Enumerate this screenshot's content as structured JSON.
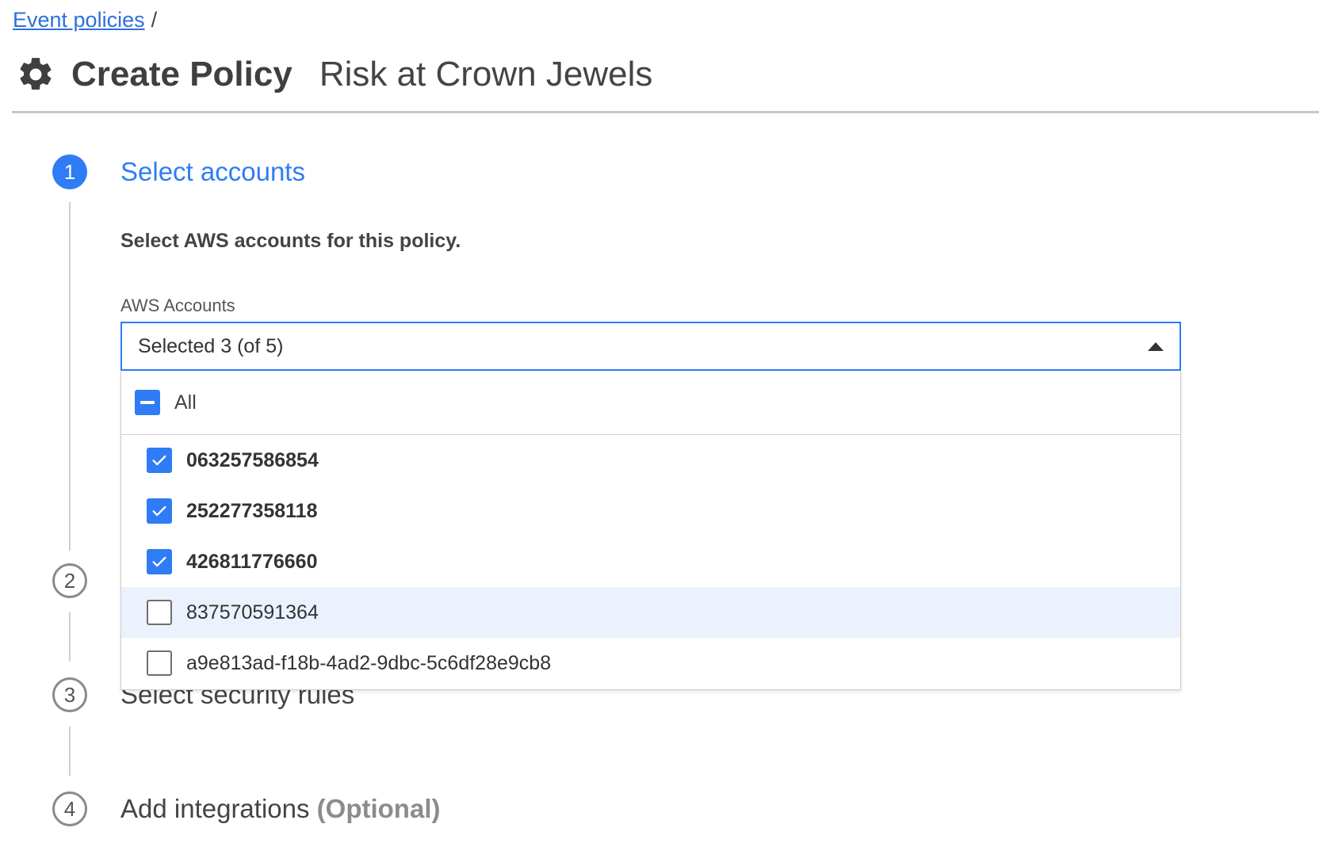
{
  "breadcrumb": {
    "link": "Event policies",
    "separator": "/"
  },
  "header": {
    "icon": "gear-icon",
    "title": "Create Policy",
    "subtitle": "Risk at Crown Jewels"
  },
  "steps": [
    {
      "number": "1",
      "label": "Select accounts",
      "state": "active"
    },
    {
      "number": "2",
      "label": "",
      "state": "inactive"
    },
    {
      "number": "3",
      "label": "Select security rules",
      "state": "inactive"
    },
    {
      "number": "4",
      "label": "Add integrations",
      "optional": "(Optional)",
      "state": "inactive"
    }
  ],
  "step1": {
    "description": "Select AWS accounts for this policy.",
    "field_label": "AWS Accounts",
    "select_value": "Selected 3 (of 5)",
    "all_option": {
      "label": "All",
      "state": "indeterminate"
    },
    "options": [
      {
        "label": "063257586854",
        "checked": true
      },
      {
        "label": "252277358118",
        "checked": true
      },
      {
        "label": "426811776660",
        "checked": true
      },
      {
        "label": "837570591364",
        "checked": false,
        "hovered": true
      },
      {
        "label": "a9e813ad-f18b-4ad2-9dbc-5c6df28e9cb8",
        "checked": false
      }
    ]
  },
  "colors": {
    "accent": "#2f7cf6",
    "link": "#2f6fdc",
    "hover_row": "#ebf2fd"
  }
}
